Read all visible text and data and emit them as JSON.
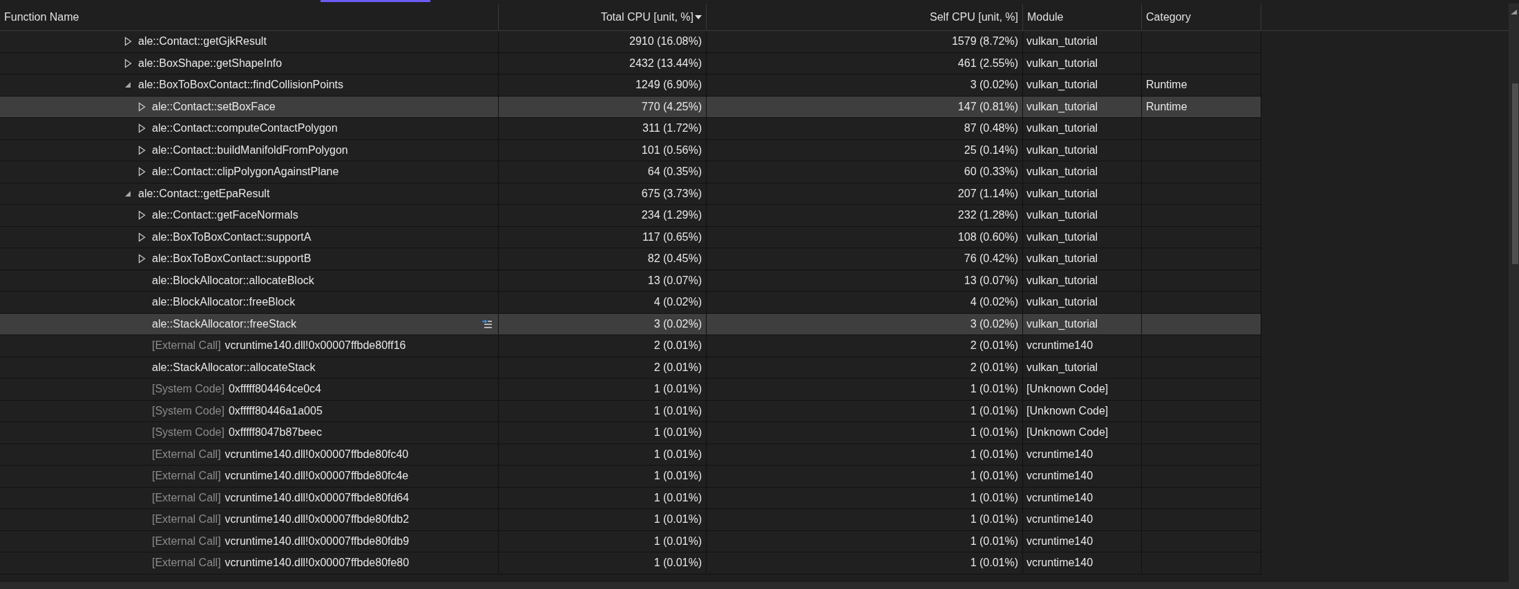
{
  "columns": [
    {
      "label": "Function Name",
      "sorted": false
    },
    {
      "label": "Total CPU [unit, %]",
      "sorted": true
    },
    {
      "label": "Self CPU [unit, %]",
      "sorted": false
    },
    {
      "label": "Module",
      "sorted": false
    },
    {
      "label": "Category",
      "sorted": false
    }
  ],
  "rows": [
    {
      "name": "ale::Contact::getGjkResult",
      "total": "2910 (16.08%)",
      "self": "1579 (8.72%)",
      "module": "vulkan_tutorial",
      "expanded": false,
      "selected": false,
      "hovered": false
    },
    {
      "name": "ale::BoxShape::getShapeInfo",
      "total": "2432 (13.44%)",
      "self": "461 (2.55%)",
      "module": "vulkan_tutorial",
      "expanded": false,
      "selected": false,
      "hovered": false
    },
    {
      "name": "ale::BoxToBoxContact::findCollisionPoints",
      "total": "1249 (6.90%)",
      "self": "3 (0.02%)",
      "module": "vulkan_tutorial",
      "category": "Runtime",
      "expanded": true,
      "selected": false,
      "hovered": false,
      "children": [
        {
          "name": "ale::Contact::setBoxFace",
          "total": "770 (4.25%)",
          "self": "147 (0.81%)",
          "module": "vulkan_tutorial",
          "category": "Runtime",
          "expanded": false,
          "selected": true,
          "hovered": false
        },
        {
          "name": "ale::Contact::computeContactPolygon",
          "total": "311 (1.72%)",
          "self": "87 (0.48%)",
          "module": "vulkan_tutorial",
          "expanded": false,
          "selected": false,
          "hovered": false
        },
        {
          "name": "ale::Contact::buildManifoldFromPolygon",
          "total": "101 (0.56%)",
          "self": "25 (0.14%)",
          "module": "vulkan_tutorial",
          "expanded": false,
          "selected": false,
          "hovered": false
        },
        {
          "name": "ale::Contact::clipPolygonAgainstPlane",
          "total": "64 (0.35%)",
          "self": "60 (0.33%)",
          "module": "vulkan_tutorial",
          "expanded": false,
          "selected": false,
          "hovered": false
        }
      ]
    },
    {
      "name": "ale::Contact::getEpaResult",
      "total": "675 (3.73%)",
      "self": "207 (1.14%)",
      "module": "vulkan_tutorial",
      "expanded": true,
      "selected": false,
      "hovered": false,
      "children": [
        {
          "name": "ale::Contact::getFaceNormals",
          "total": "234 (1.29%)",
          "self": "232 (1.28%)",
          "module": "vulkan_tutorial",
          "expanded": false,
          "selected": false,
          "hovered": false
        },
        {
          "name": "ale::BoxToBoxContact::supportA",
          "total": "117 (0.65%)",
          "self": "108 (0.60%)",
          "module": "vulkan_tutorial",
          "expanded": false,
          "selected": false,
          "hovered": false
        },
        {
          "name": "ale::BoxToBoxContact::supportB",
          "total": "82 (0.45%)",
          "self": "76 (0.42%)",
          "module": "vulkan_tutorial",
          "expanded": false,
          "selected": false,
          "hovered": false
        },
        {
          "name": "ale::BlockAllocator::allocateBlock",
          "total": "13 (0.07%)",
          "self": "13 (0.07%)",
          "module": "vulkan_tutorial",
          "selected": false,
          "hovered": false
        },
        {
          "name": "ale::BlockAllocator::freeBlock",
          "total": "4 (0.02%)",
          "self": "4 (0.02%)",
          "module": "vulkan_tutorial",
          "selected": false,
          "hovered": false
        },
        {
          "name": "ale::StackAllocator::freeStack",
          "total": "3 (0.02%)",
          "self": "3 (0.02%)",
          "module": "vulkan_tutorial",
          "selected": true,
          "hovered": true
        },
        {
          "tag": "[External Call]",
          "name": "vcruntime140.dll!0x00007ffbde80ff16",
          "total": "2 (0.01%)",
          "self": "2 (0.01%)",
          "module": "vcruntime140",
          "selected": false,
          "hovered": false
        },
        {
          "name": "ale::StackAllocator::allocateStack",
          "total": "2 (0.01%)",
          "self": "2 (0.01%)",
          "module": "vulkan_tutorial",
          "selected": false,
          "hovered": false
        },
        {
          "tag": "[System Code]",
          "name": "0xfffff804464ce0c4",
          "total": "1 (0.01%)",
          "self": "1 (0.01%)",
          "module": "[Unknown Code]",
          "selected": false,
          "hovered": false
        },
        {
          "tag": "[System Code]",
          "name": "0xfffff80446a1a005",
          "total": "1 (0.01%)",
          "self": "1 (0.01%)",
          "module": "[Unknown Code]",
          "selected": false,
          "hovered": false
        },
        {
          "tag": "[System Code]",
          "name": "0xfffff8047b87beec",
          "total": "1 (0.01%)",
          "self": "1 (0.01%)",
          "module": "[Unknown Code]",
          "selected": false,
          "hovered": false
        },
        {
          "tag": "[External Call]",
          "name": "vcruntime140.dll!0x00007ffbde80fc40",
          "total": "1 (0.01%)",
          "self": "1 (0.01%)",
          "module": "vcruntime140",
          "selected": false,
          "hovered": false
        },
        {
          "tag": "[External Call]",
          "name": "vcruntime140.dll!0x00007ffbde80fc4e",
          "total": "1 (0.01%)",
          "self": "1 (0.01%)",
          "module": "vcruntime140",
          "selected": false,
          "hovered": false
        },
        {
          "tag": "[External Call]",
          "name": "vcruntime140.dll!0x00007ffbde80fd64",
          "total": "1 (0.01%)",
          "self": "1 (0.01%)",
          "module": "vcruntime140",
          "selected": false,
          "hovered": false
        },
        {
          "tag": "[External Call]",
          "name": "vcruntime140.dll!0x00007ffbde80fdb2",
          "total": "1 (0.01%)",
          "self": "1 (0.01%)",
          "module": "vcruntime140",
          "selected": false,
          "hovered": false
        },
        {
          "tag": "[External Call]",
          "name": "vcruntime140.dll!0x00007ffbde80fdb9",
          "total": "1 (0.01%)",
          "self": "1 (0.01%)",
          "module": "vcruntime140",
          "selected": false,
          "hovered": false
        },
        {
          "tag": "[External Call]",
          "name": "vcruntime140.dll!0x00007ffbde80fe80",
          "total": "1 (0.01%)",
          "self": "1 (0.01%)",
          "module": "vcruntime140",
          "selected": false,
          "hovered": false
        }
      ]
    }
  ]
}
